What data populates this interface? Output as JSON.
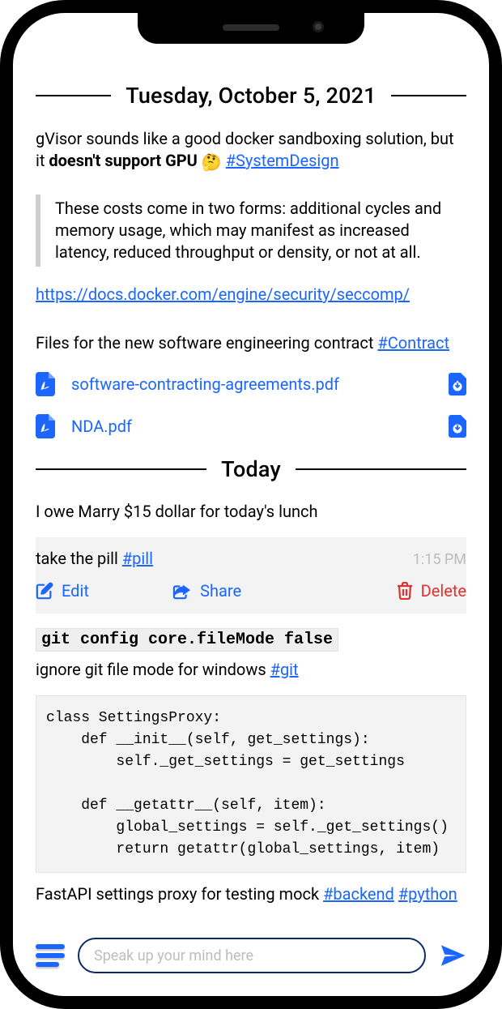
{
  "colors": {
    "accent": "#1b66ff",
    "danger": "#e03030",
    "muted": "#bdbdbd"
  },
  "date1": {
    "label": "Tuesday, October 5, 2021"
  },
  "note1": {
    "prefix": "gVisor sounds like a good docker sandboxing solution, but it ",
    "bold": "doesn't support GPU",
    "emoji": "🤔",
    "tag": "#SystemDesign"
  },
  "quote": {
    "text": "These costs come in two forms: additional cycles and memory usage, which may manifest as increased latency, reduced throughput or density, or not at all."
  },
  "link1": {
    "url": "https://docs.docker.com/engine/security/seccomp/"
  },
  "files": {
    "title_prefix": "Files for the new software engineering contract ",
    "tag": "#Contract",
    "items": [
      {
        "name": "software-contracting-agreements.pdf"
      },
      {
        "name": "NDA.pdf"
      }
    ]
  },
  "date2": {
    "label": "Today"
  },
  "note2": {
    "text": "I owe Marry $15 dollar for today's lunch"
  },
  "pill": {
    "text_prefix": "take the pill ",
    "tag": "#pill",
    "time": "1:15 PM"
  },
  "actions": {
    "edit": "Edit",
    "share": "Share",
    "delete": "Delete"
  },
  "git": {
    "code": "git config core.fileMode false",
    "desc_prefix": "ignore git file mode for windows ",
    "tag": "#git"
  },
  "codeblock": {
    "text": "class SettingsProxy:\n    def __init__(self, get_settings):\n        self._get_settings = get_settings\n\n    def __getattr__(self, item):\n        global_settings = self._get_settings()\n        return getattr(global_settings, item)"
  },
  "fastapi": {
    "prefix": "FastAPI settings proxy for testing mock ",
    "tag1": "#backend",
    "tag2": "#python"
  },
  "input": {
    "placeholder": "Speak up your  mind here"
  }
}
